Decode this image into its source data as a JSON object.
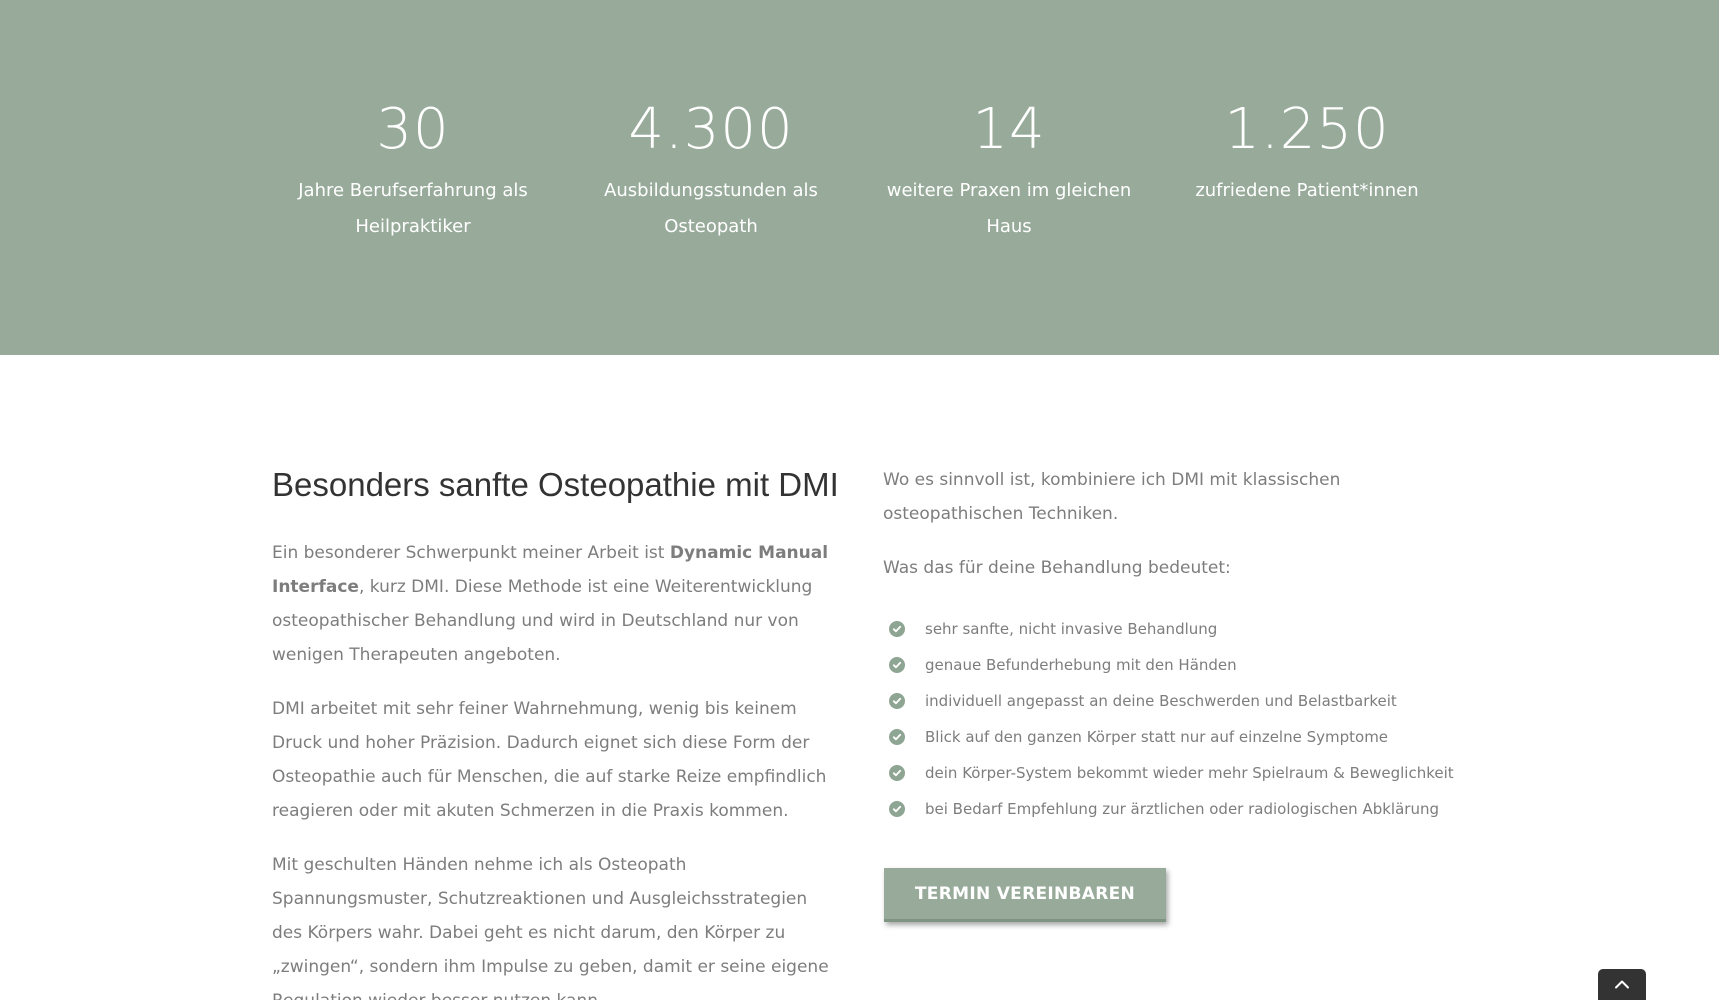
{
  "colors": {
    "band_bg": "#98ab9b",
    "accent": "#8fa593",
    "heading": "#333333",
    "body_text": "#7d7d7d",
    "to_top_bg": "#333333"
  },
  "stats": [
    {
      "number": "30",
      "label": "Jahre Berufserfahrung als Heilpraktiker"
    },
    {
      "number": "4.300",
      "label": "Ausbildungsstunden als Osteopath"
    },
    {
      "number": "14",
      "label": "weitere Praxen im gleichen Haus"
    },
    {
      "number": "1.250",
      "label": "zufriedene Patient*innen"
    }
  ],
  "left": {
    "heading": "Besonders sanfte Osteopathie mit DMI",
    "p1_before": "Ein besonderer Schwerpunkt meiner Arbeit ist ",
    "p1_bold": "Dynamic Manual Interface",
    "p1_after": ", kurz DMI. Diese Methode ist eine Weiterentwicklung osteopathischer Behandlung und wird in Deutschland nur von wenigen Therapeuten angeboten.",
    "p2": "DMI arbeitet mit sehr feiner Wahrnehmung, wenig bis keinem Druck und hoher Präzision. Dadurch eignet sich diese Form der Osteopathie auch für Menschen, die auf starke Reize empfindlich reagieren oder mit akuten Schmerzen in die Praxis kommen.",
    "p3": "Mit geschulten Händen nehme ich als Osteopath Spannungsmuster, Schutzreaktionen und Ausgleichsstrategien des Körpers wahr. Dabei geht es nicht darum, den Körper zu „zwingen“, sondern ihm Impulse zu geben, damit er seine eigene Regulation wieder besser nutzen kann."
  },
  "right": {
    "p1": "Wo es sinnvoll ist, kombiniere ich DMI mit klassischen osteopathischen Techniken.",
    "p2": "Was das für deine Behandlung bedeutet:",
    "checklist": [
      "sehr sanfte, nicht invasive Behandlung",
      "genaue Befunderhebung mit den Händen",
      "individuell angepasst an deine Beschwerden und Belastbarkeit",
      "Blick auf den ganzen Körper statt nur auf einzelne Symptome",
      "dein Körper-System bekommt wieder mehr Spielraum & Beweglichkeit",
      "bei Bedarf Empfehlung zur ärztlichen oder radiologischen Abklärung"
    ],
    "cta_label": "Termin vereinbaren"
  },
  "icons": {
    "check": "check-circle-icon",
    "to_top": "chevron-up-icon"
  }
}
